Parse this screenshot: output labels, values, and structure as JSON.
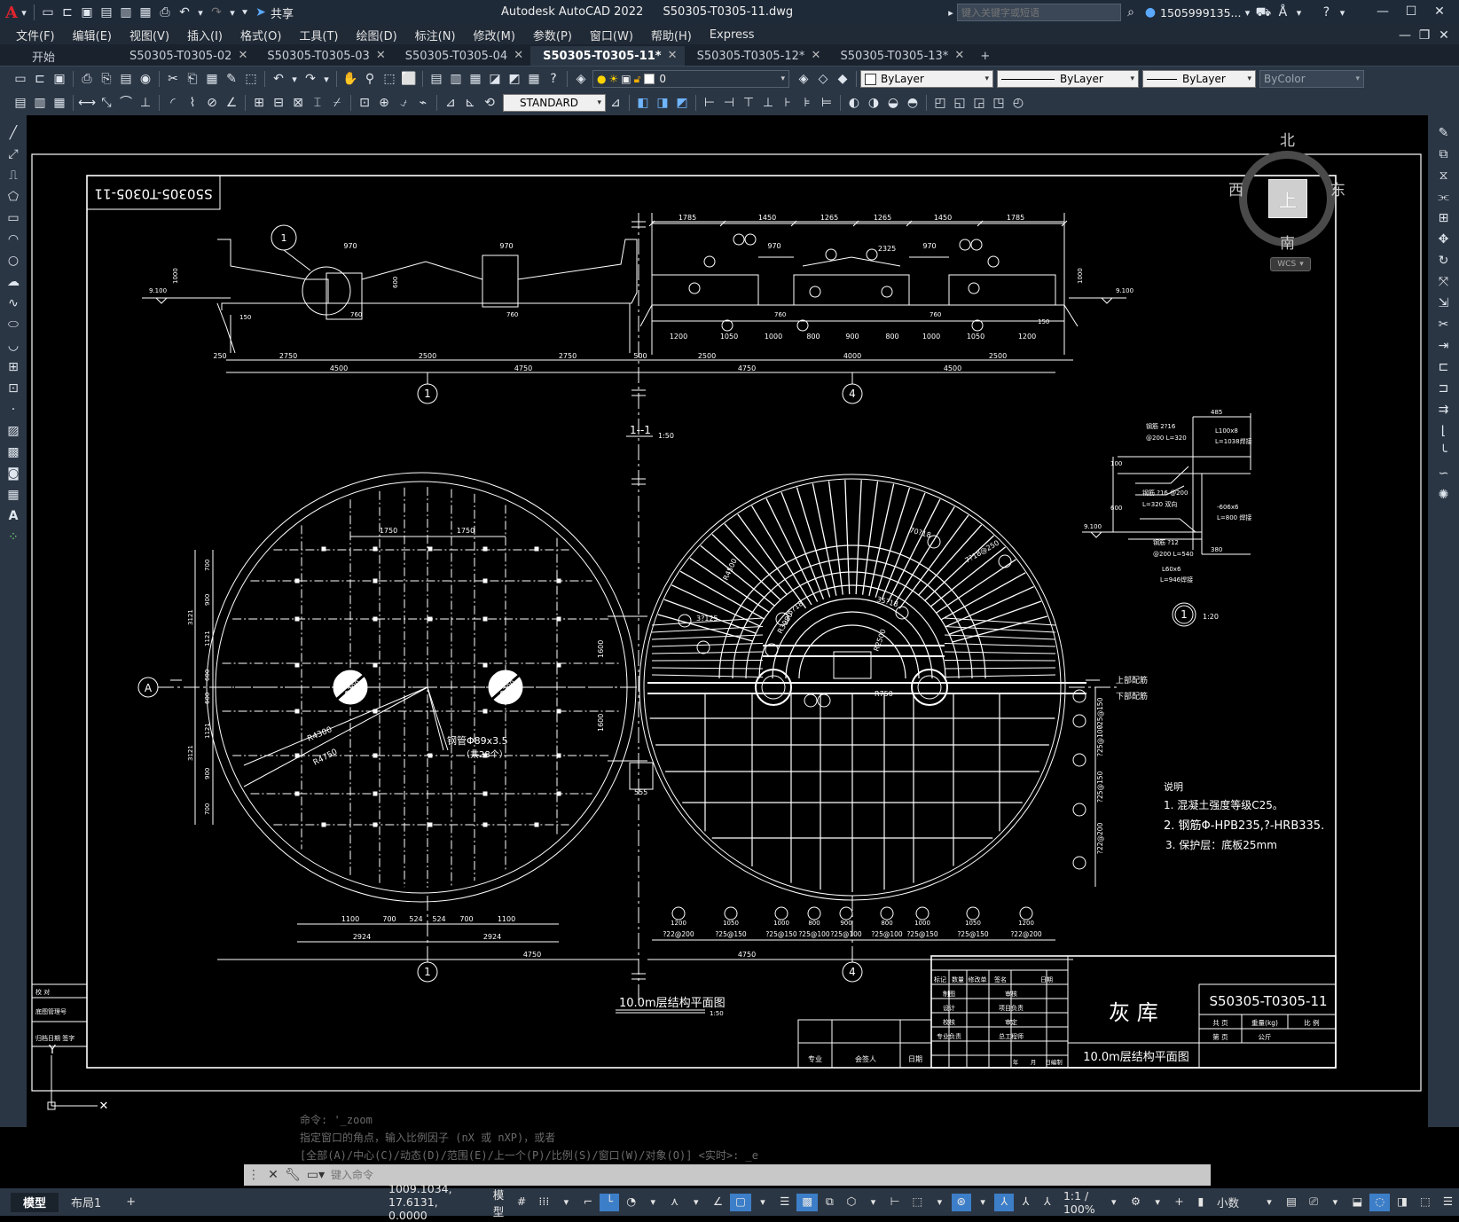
{
  "app": {
    "title": "Autodesk AutoCAD 2022",
    "file": "S50305-T0305-11.dwg",
    "share_label": "共享",
    "search_placeholder": "键入关键字或短语",
    "user": "1505999135...",
    "accent_red": "#e0242e"
  },
  "menu": {
    "items": [
      "文件(F)",
      "编辑(E)",
      "视图(V)",
      "插入(I)",
      "格式(O)",
      "工具(T)",
      "绘图(D)",
      "标注(N)",
      "修改(M)",
      "参数(P)",
      "窗口(W)",
      "帮助(H)",
      "Express"
    ]
  },
  "tabs": {
    "start": "开始",
    "items": [
      "S50305-T0305-02",
      "S50305-T0305-03",
      "S50305-T0305-04",
      "S50305-T0305-11*",
      "S50305-T0305-12*",
      "S50305-T0305-13*"
    ],
    "active_index": 3,
    "add": "+"
  },
  "toolbar": {
    "layer": "0",
    "color": "ByLayer",
    "linetype": "ByLayer",
    "lineweight": "ByLayer",
    "plotstyle": "ByColor",
    "textstyle": "STANDARD"
  },
  "viewcube": {
    "north": "北",
    "south": "南",
    "east": "东",
    "west": "西",
    "top": "上",
    "wcs": "WCS"
  },
  "drawing": {
    "stamp": "S50305-T0305-11",
    "section_label": "1--1",
    "section_scale": "1:50",
    "plan_title": "10.0m层结构平面图",
    "plan_scale": "1:50",
    "detail_label": "1",
    "detail_scale": "1:20",
    "axis_1": "1",
    "axis_4": "4",
    "axis_A": "A",
    "top_dims": [
      "1785",
      "1450",
      "1265",
      "1265",
      "1450",
      "1785"
    ],
    "mid_dims_left": [
      "970",
      "970"
    ],
    "mid_dims_right": [
      "970",
      "2325",
      "970"
    ],
    "lower_dims_left": [
      "250",
      "2750",
      "2500",
      "2750",
      "500"
    ],
    "lower_dims_right": [
      "2500",
      "4000",
      "2500"
    ],
    "total_dims": [
      "4500",
      "4750",
      "4750",
      "4500"
    ],
    "beam_dims_right": [
      "1200",
      "1050",
      "1000",
      "800",
      "900",
      "800",
      "1000",
      "1050",
      "1200"
    ],
    "small_dims": [
      "760",
      "760",
      "760",
      "760",
      "150",
      "150",
      "9.100",
      "9.100",
      "1000",
      "1000",
      "600"
    ],
    "left_plan_dims_top": [
      "1750",
      "1750"
    ],
    "left_plan_dims_bottom": [
      "1100",
      "700",
      "524",
      "524",
      "700",
      "1100"
    ],
    "left_plan_dims_bottom2": [
      "2924",
      "2924"
    ],
    "left_plan_dims_side": [
      "700",
      "900",
      "1121",
      "600",
      "600",
      "1121",
      "900",
      "700"
    ],
    "left_plan_dims_side2": [
      "3121",
      "3121"
    ],
    "plan_total": "4750",
    "left_plan_radii": [
      "R4300",
      "R4750"
    ],
    "pipe_note": "钢管Φ89x3.5",
    "pipe_count": "（共28个）",
    "pipe_label": "Φ700",
    "hole_dim": "1600",
    "hole_dim2": "555",
    "right_plan_radii": [
      "R4500",
      "R3980",
      "R2500",
      "R750"
    ],
    "rebar_labels": [
      "70?18",
      "7?18@250",
      "35?18",
      "15?18",
      "3?125"
    ],
    "bottom_rebar": [
      "?22@200",
      "?25@150",
      "?25@150",
      "?25@100",
      "?25@100",
      "?25@100",
      "?25@150",
      "?25@150",
      "?22@200"
    ],
    "side_rebar": [
      "?25@150",
      "?25@100",
      "?25@150",
      "?22@200"
    ],
    "upper_lower": [
      "上部配筋",
      "下部配筋"
    ],
    "detail_notes": [
      "钢筋 2?16",
      "@200 L=320",
      "L100x8",
      "L=1038焊接",
      "钢筋 ?16 @200",
      "L=320 双向",
      "-606x6",
      "L=800 焊接",
      "钢筋 ?12",
      "@200 L=540",
      "L60x6",
      "L=946焊接",
      "485",
      "380",
      "100",
      "600",
      "9.100"
    ],
    "notes_title": "说明",
    "notes": [
      "1. 混凝土强度等级C25。",
      "2. 钢筋Φ-HPB235,?-HRB335.",
      "3. 保护层：底板25mm"
    ]
  },
  "titleblock": {
    "project": "灰 库",
    "drawing_no": "S50305-T0305-11",
    "drawing_name": "10.0m层结构平面图",
    "row_headers": [
      "标记",
      "数量",
      "修改单",
      "签名",
      "日期"
    ],
    "roles_left": [
      "制图",
      "设计",
      "校核",
      "专业负责"
    ],
    "roles_right": [
      "审核",
      "项目负责",
      "审定",
      "总工程师"
    ],
    "sheet_labels": [
      "共 页",
      "重量(kg)",
      "比 例",
      "第 页",
      "公斤"
    ],
    "sign_labels": [
      "专业",
      "会签人",
      "日期"
    ],
    "date_labels": [
      "年",
      "月",
      "日编制"
    ],
    "left_strip": [
      "校 对",
      "底图管理号",
      "归档日期 签字"
    ]
  },
  "command": {
    "history": [
      "命令: '_zoom",
      "指定窗口的角点，输入比例因子 (nX 或 nXP)，或者",
      "[全部(A)/中心(C)/动态(D)/范围(E)/上一个(P)/比例(S)/窗口(W)/对象(O)] <实时>: _e"
    ],
    "placeholder": "键入命令"
  },
  "layouts": {
    "model": "模型",
    "layout1": "布局1",
    "add": "+"
  },
  "status": {
    "coords": "1009.1034, 17.6131, 0.0000",
    "space": "模型",
    "scale": "1:1 / 100%",
    "units": "小数"
  }
}
